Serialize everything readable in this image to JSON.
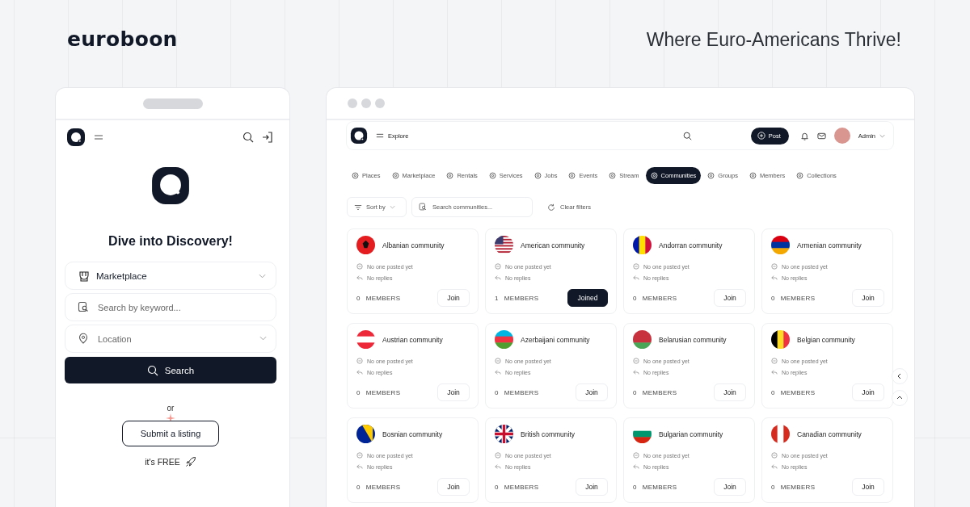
{
  "brand": {
    "logo": "euroboon",
    "tagline": "Where Euro-Americans Thrive!"
  },
  "mobile": {
    "hero_title": "Dive into Discovery!",
    "category": {
      "value": "Marketplace"
    },
    "keyword": {
      "placeholder": "Search by keyword..."
    },
    "location": {
      "placeholder": "Location"
    },
    "search_button": "Search",
    "or": "or",
    "submit_button": "Submit a listing",
    "free_note": "it's FREE"
  },
  "browser": {
    "topbar": {
      "menu_label": "Explore",
      "post_button": "Post",
      "user": "Admin"
    },
    "tabs": [
      {
        "label": "Places",
        "selected": false
      },
      {
        "label": "Marketplace",
        "selected": false
      },
      {
        "label": "Rentals",
        "selected": false
      },
      {
        "label": "Services",
        "selected": false
      },
      {
        "label": "Jobs",
        "selected": false
      },
      {
        "label": "Events",
        "selected": false
      },
      {
        "label": "Stream",
        "selected": false
      },
      {
        "label": "Communities",
        "selected": true
      },
      {
        "label": "Groups",
        "selected": false
      },
      {
        "label": "Members",
        "selected": false
      },
      {
        "label": "Collections",
        "selected": false
      }
    ],
    "filters": {
      "sort": "Sort by",
      "search_placeholder": "Search communities...",
      "clear": "Clear filters"
    },
    "communities": [
      {
        "name": "Albanian community",
        "posts": "No one posted yet",
        "replies": "No replies",
        "members": "0",
        "members_label": "MEMBERS",
        "button": "Join",
        "joined": false
      },
      {
        "name": "American community",
        "posts": "No one posted yet",
        "replies": "No replies",
        "members": "1",
        "members_label": "MEMBERS",
        "button": "Joined",
        "joined": true
      },
      {
        "name": "Andorran community",
        "posts": "No one posted yet",
        "replies": "No replies",
        "members": "0",
        "members_label": "MEMBERS",
        "button": "Join",
        "joined": false
      },
      {
        "name": "Armenian community",
        "posts": "No one posted yet",
        "replies": "No replies",
        "members": "0",
        "members_label": "MEMBERS",
        "button": "Join",
        "joined": false
      },
      {
        "name": "Austrian community",
        "posts": "No one posted yet",
        "replies": "No replies",
        "members": "0",
        "members_label": "MEMBERS",
        "button": "Join",
        "joined": false
      },
      {
        "name": "Azerbaijani community",
        "posts": "No one posted yet",
        "replies": "No replies",
        "members": "0",
        "members_label": "MEMBERS",
        "button": "Join",
        "joined": false
      },
      {
        "name": "Belarusian community",
        "posts": "No one posted yet",
        "replies": "No replies",
        "members": "0",
        "members_label": "MEMBERS",
        "button": "Join",
        "joined": false
      },
      {
        "name": "Belgian community",
        "posts": "No one posted yet",
        "replies": "No replies",
        "members": "0",
        "members_label": "MEMBERS",
        "button": "Join",
        "joined": false
      },
      {
        "name": "Bosnian community",
        "posts": "No one posted yet",
        "replies": "No replies",
        "members": "0",
        "members_label": "MEMBERS",
        "button": "Join",
        "joined": false
      },
      {
        "name": "British community",
        "posts": "No one posted yet",
        "replies": "No replies",
        "members": "0",
        "members_label": "MEMBERS",
        "button": "Join",
        "joined": false
      },
      {
        "name": "Bulgarian community",
        "posts": "No one posted yet",
        "replies": "No replies",
        "members": "0",
        "members_label": "MEMBERS",
        "button": "Join",
        "joined": false
      },
      {
        "name": "Canadian community",
        "posts": "No one posted yet",
        "replies": "No replies",
        "members": "0",
        "members_label": "MEMBERS",
        "button": "Join",
        "joined": false
      }
    ]
  }
}
